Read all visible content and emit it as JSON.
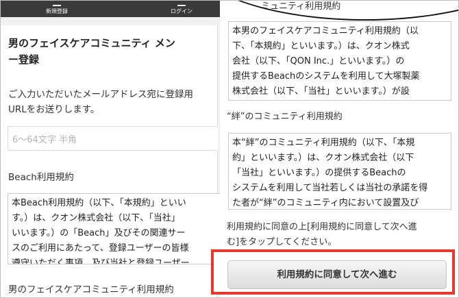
{
  "left": {
    "nav": [
      {
        "label": "新規登録",
        "icon": "user-plus-icon"
      },
      {
        "label": "ログイン",
        "icon": "login-icon"
      }
    ],
    "title_line1": "男のフェイスケアコミュニティ メン",
    "title_line2": "ー登録",
    "description_line1": "ご入力いただいたメールアドレス宛に登録用",
    "description_line2": "URLをお送りします。",
    "password_placeholder": "6〜64文字 半角",
    "beach_terms_heading": "Beach利用規約",
    "beach_terms_text": "本Beach利用規約（以下、「本規約」といい\nす。）は、クオン株式会社（以下、「当社」\nいいます。）の「Beach」及びその関連サー\nスのご利用にあたって、登録ユーザーの皆様\n遵守いただく事項、及び当社と登録ユーザー\n皆様との間の権利義務関係について定める規",
    "community_terms_heading": "男のフェイスケアコミュニティ利用規約"
  },
  "right": {
    "top_partial_heading": "ミュニティ利用規約",
    "community_terms_text": "本男のフェイスケアコミュニティ利用規約（以\n下、「本規約」といいます。）は、クオン株式\n会社（以下、「QON Inc.」といいます。）の\n提供するBeachのシステムを利用して大塚製薬\n株式会社（以下、「当社」といいます。）が設\n置及び運営するサイト・タルのご利用にあたり、こ",
    "kizuna_heading": "“絆”のコミュニティ利用規約",
    "kizuna_terms_text": "本“絆”のコミュニティ利用規約（以下、「本規\n約」といいます。）は、クオン株式会社（以下\n「当社」といいます。）の提供するBeachの\nシステムを利用して当社若しくは当社の承諾を得\nた者が“絆”のコミュニティ内において設置及び\n運営するサイト・タルのご利用にあたり、ユーザ",
    "consent_line1": "利用規約に同意の上[利用規約に同意して次へ進",
    "consent_line2": "む]をタップしてください。",
    "agree_button": "利用規約に同意して次へ進む"
  },
  "colors": {
    "highlight": "#e23b2e",
    "topbar": "#3a3a3a"
  }
}
